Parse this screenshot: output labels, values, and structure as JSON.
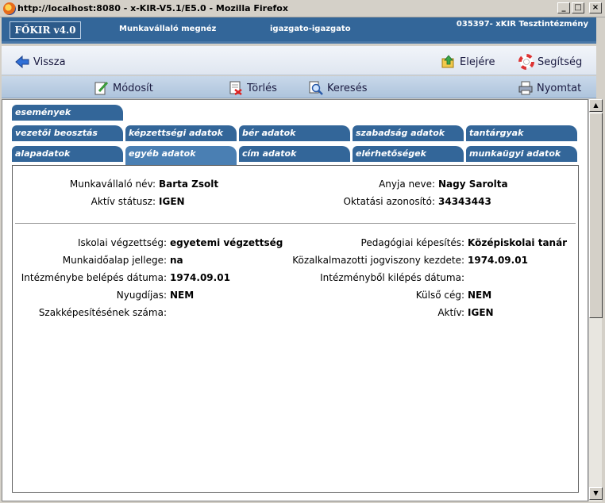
{
  "window": {
    "title": "http://localhost:8080 - x-KIR-V5.1/E5.0 - Mozilla Firefox"
  },
  "header": {
    "logo": "FŐKIR v4.0",
    "page": "Munkavállaló megnéz",
    "user": "igazgato-igazgato",
    "institution": "035397- xKIR Tesztintézmény"
  },
  "nav": {
    "back": "Vissza",
    "top": "Elejére",
    "help": "Segítség"
  },
  "toolbar": {
    "edit": "Módosít",
    "delete": "Törlés",
    "search": "Keresés",
    "print": "Nyomtat"
  },
  "tabs": {
    "row1": [
      "események"
    ],
    "row2": [
      "vezetői beosztás",
      "képzettségi adatok",
      "bér adatok",
      "szabadság adatok",
      "tantárgyak"
    ],
    "row3": [
      "alapadatok",
      "egyéb adatok",
      "cím adatok",
      "elérhetőségek",
      "munkaügyi adatok"
    ],
    "active": "egyéb adatok"
  },
  "top_fields": {
    "name_label": "Munkavállaló név:",
    "name_value": "Barta Zsolt",
    "status_label": "Aktív státusz:",
    "status_value": "IGEN",
    "mother_label": "Anyja neve:",
    "mother_value": "Nagy Sarolta",
    "edu_id_label": "Oktatási azonosító:",
    "edu_id_value": "34343443"
  },
  "left_fields": [
    {
      "label": "Iskolai végzettség:",
      "value": "egyetemi végzettség"
    },
    {
      "label": "Munkaidőalap jellege:",
      "value": "na"
    },
    {
      "label": "Intézménybe belépés dátuma:",
      "value": "1974.09.01"
    },
    {
      "label": "Nyugdíjas:",
      "value": "NEM"
    },
    {
      "label": "Szakképesítésének száma:",
      "value": ""
    }
  ],
  "right_fields": [
    {
      "label": "Pedagógiai képesítés:",
      "value": "Középiskolai tanár"
    },
    {
      "label": "Közalkalmazotti jogviszony kezdete:",
      "value": "1974.09.01"
    },
    {
      "label": "Intézményből kilépés dátuma:",
      "value": ""
    },
    {
      "label": "Külső cég:",
      "value": "NEM"
    },
    {
      "label": "Aktív:",
      "value": "IGEN"
    }
  ],
  "colors": {
    "header": "#336699",
    "tab": "#336699",
    "tab_active": "#4a7fb3"
  }
}
